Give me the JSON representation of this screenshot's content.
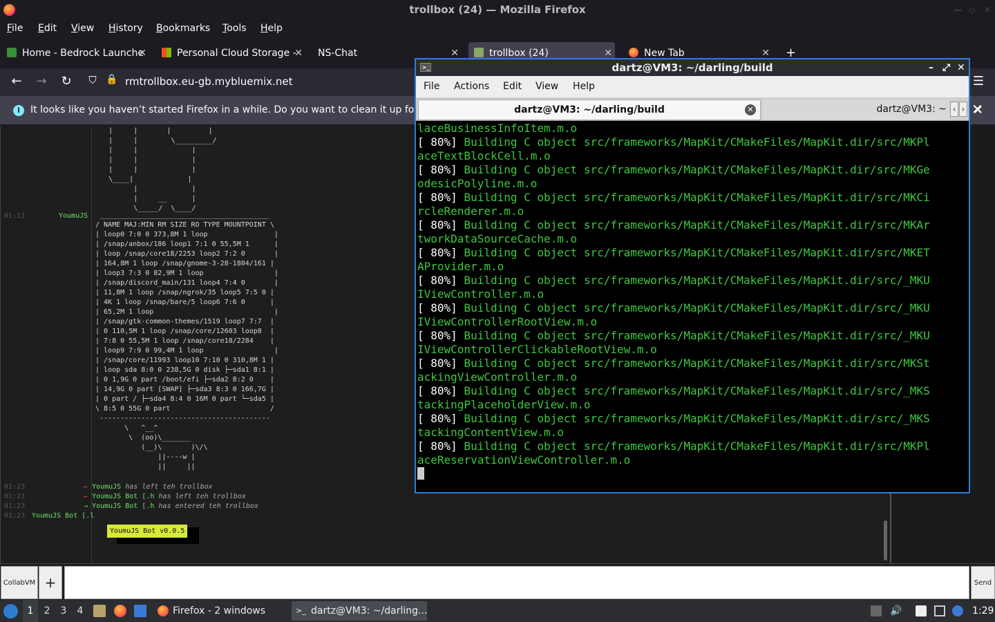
{
  "window_title": "trollbox (24) — Mozilla Firefox",
  "ff_menu": [
    "File",
    "Edit",
    "View",
    "History",
    "Bookmarks",
    "Tools",
    "Help"
  ],
  "tabs": [
    {
      "label": "Home - Bedrock Launche",
      "icon": "puzzle-icon"
    },
    {
      "label": "Personal Cloud Storage -",
      "icon": "windows-logo-icon"
    },
    {
      "label": "NS-Chat",
      "icon": ""
    },
    {
      "label": "trollbox (24)",
      "icon": "trollbox-icon"
    },
    {
      "label": "New Tab",
      "icon": "firefox-icon"
    }
  ],
  "new_tab_symbol": "+",
  "url": "rmtrollbox.eu-gb.mybluemix.net",
  "notice": "It looks like you haven’t started Firefox in a while. Do you want to clean it up for a f",
  "chat": {
    "ascii_top": "    |     |       |         |\n    |     |        \\_________/\n    |     |             |\n    |     |             |\n    |     |             |\n    \\____|             |\n          |             |\n          |     __      |\n          \\_____/  \\____/",
    "entry1_time": "01:13",
    "entry1_nick": "YoumuJS",
    "lsblk": " _________________________________________\n/ NAME MAJ:MIN RM SIZE RO TYPE MOUNTPOINT \\\n| loop0 7:0 0 373,8M 1 loop                |\n| /snap/anbox/186 loop1 7:1 0 55,5M 1      |\n| loop /snap/core18/2253 loop2 7:2 0       |\n| 164,8M 1 loop /snap/gnome-3-28-1804/161 |\n| loop3 7:3 0 82,9M 1 loop                 |\n| /snap/discord_main/131 loop4 7:4 0       |\n| 11,8M 1 loop /snap/ngrok/35 loop5 7:5 0 |\n| 4K 1 loop /snap/bare/5 loop6 7:6 0      |\n| 65,2M 1 loop                             |\n| /snap/gtk-common-themes/1519 loop7 7:7  |\n| 0 110,5M 1 loop /snap/core/12603 loop8  |\n| 7:8 0 55,5M 1 loop /snap/core18/2284    |\n| loop9 7:9 0 99,4M 1 loop                 |\n| /snap/core/11993 loop10 7:10 0 310,8M 1 |\n| loop sda 8:0 0 238,5G 0 disk ├─sda1 8:1 |\n| 0 1,9G 0 part /boot/efi ├─sda2 8:2 0    |\n| 14,9G 0 part [SWAP] ├─sda3 8:3 0 166,7G |\n| 0 part / ├─sda4 8:4 0 16M 0 part └─sda5 |\n\\ 8:5 0 55G 0 part                        /\n -----------------------------------------",
    "cow": "       \\   ^__^\n        \\  (oo)\\_______\n           (__)\\       )\\/\\\n               ||----w |\n               ||     ||",
    "events": [
      {
        "time": "01:23",
        "arrow": "←",
        "nick": "YoumuJS",
        "text": "has left teh trollbox"
      },
      {
        "time": "01:23",
        "arrow": "←",
        "nick": "YoumuJS Bot [.h",
        "text": "has left teh trollbox"
      },
      {
        "time": "01:23",
        "arrow": "→",
        "nick": "YoumuJS Bot [.h",
        "text": "has entered teh trollbox"
      }
    ],
    "last_time": "01:23",
    "last_nick": "YoumuJS Bot [.l",
    "bot_badge": "YoumuJS Bot v0.0.5",
    "collab_label": "CollabVM",
    "plus_label": "+",
    "send_label": "Send"
  },
  "terminal": {
    "title": "dartz@VM3: ~/darling/build",
    "menu": [
      "File",
      "Actions",
      "Edit",
      "View",
      "Help"
    ],
    "tab_active": "dartz@VM3: ~/darling/build",
    "tab_second": "dartz@VM3: ~",
    "lines": [
      {
        "pct": "",
        "text": "laceBusinessInfoItem.m.o"
      },
      {
        "pct": "[ 80%]",
        "text": " Building C object src/frameworks/MapKit/CMakeFiles/MapKit.dir/src/MKPl"
      },
      {
        "pct": "",
        "text": "aceTextBlockCell.m.o"
      },
      {
        "pct": "[ 80%]",
        "text": " Building C object src/frameworks/MapKit/CMakeFiles/MapKit.dir/src/MKGe"
      },
      {
        "pct": "",
        "text": "odesicPolyline.m.o"
      },
      {
        "pct": "[ 80%]",
        "text": " Building C object src/frameworks/MapKit/CMakeFiles/MapKit.dir/src/MKCi"
      },
      {
        "pct": "",
        "text": "rcleRenderer.m.o"
      },
      {
        "pct": "[ 80%]",
        "text": " Building C object src/frameworks/MapKit/CMakeFiles/MapKit.dir/src/MKAr"
      },
      {
        "pct": "",
        "text": "tworkDataSourceCache.m.o"
      },
      {
        "pct": "[ 80%]",
        "text": " Building C object src/frameworks/MapKit/CMakeFiles/MapKit.dir/src/MKET"
      },
      {
        "pct": "",
        "text": "AProvider.m.o"
      },
      {
        "pct": "[ 80%]",
        "text": " Building C object src/frameworks/MapKit/CMakeFiles/MapKit.dir/src/_MKU"
      },
      {
        "pct": "",
        "text": "IViewController.m.o"
      },
      {
        "pct": "[ 80%]",
        "text": " Building C object src/frameworks/MapKit/CMakeFiles/MapKit.dir/src/_MKU"
      },
      {
        "pct": "",
        "text": "IViewControllerRootView.m.o"
      },
      {
        "pct": "[ 80%]",
        "text": " Building C object src/frameworks/MapKit/CMakeFiles/MapKit.dir/src/_MKU"
      },
      {
        "pct": "",
        "text": "IViewControllerClickableRootView.m.o"
      },
      {
        "pct": "[ 80%]",
        "text": " Building C object src/frameworks/MapKit/CMakeFiles/MapKit.dir/src/MKSt"
      },
      {
        "pct": "",
        "text": "ackingViewController.m.o"
      },
      {
        "pct": "[ 80%]",
        "text": " Building C object src/frameworks/MapKit/CMakeFiles/MapKit.dir/src/_MKS"
      },
      {
        "pct": "",
        "text": "tackingPlaceholderView.m.o"
      },
      {
        "pct": "[ 80%]",
        "text": " Building C object src/frameworks/MapKit/CMakeFiles/MapKit.dir/src/_MKS"
      },
      {
        "pct": "",
        "text": "tackingContentView.m.o"
      },
      {
        "pct": "[ 80%]",
        "text": " Building C object src/frameworks/MapKit/CMakeFiles/MapKit.dir/src/MKPl"
      },
      {
        "pct": "",
        "text": "aceReservationViewController.m.o"
      }
    ]
  },
  "taskbar": {
    "workspaces": [
      "1",
      "2",
      "3",
      "4"
    ],
    "tasks": [
      {
        "label": "Firefox - 2 windows"
      },
      {
        "label": "dartz@VM3: ~/darling..."
      }
    ],
    "clock": "1:29"
  },
  "colors": {
    "terminal_green": "#3ec83e",
    "accent_blue": "#2f7fd6",
    "bot_badge": "#d7ea3a"
  }
}
